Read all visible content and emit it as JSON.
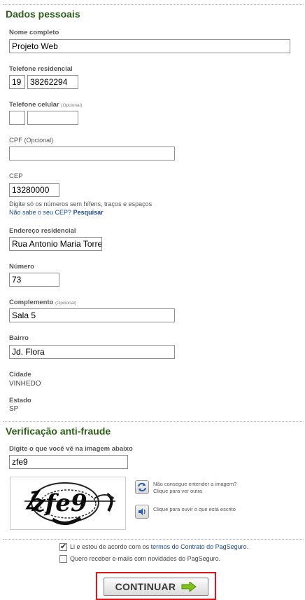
{
  "personal": {
    "title": "Dados pessoais",
    "name": {
      "label": "Nome completo",
      "value": "Projeto Web"
    },
    "home_phone": {
      "label": "Telefone residencial",
      "ddd": "19",
      "number": "38262294"
    },
    "mobile_phone": {
      "label": "Telefone celular",
      "optional": "(Opcional)",
      "ddd": "",
      "number": ""
    },
    "cpf": {
      "label": "CPF",
      "optional": "(Opcional)",
      "value": ""
    },
    "cep": {
      "label": "CEP",
      "value": "13280000",
      "hint": "Digite só os números sem hífens, traços e espaços",
      "forgot": "Não sabe o seu CEP?",
      "search_link": "Pesquisar"
    },
    "address": {
      "label": "Endereço residencial",
      "value": "Rua Antonio Maria Torre"
    },
    "number": {
      "label": "Número",
      "value": "73"
    },
    "complement": {
      "label": "Complemento",
      "optional": "(Opcional)",
      "value": "Sala 5"
    },
    "district": {
      "label": "Bairro",
      "value": "Jd. Flora"
    },
    "city": {
      "label": "Cidade",
      "value": "VINHEDO"
    },
    "state": {
      "label": "Estado",
      "value": "SP"
    }
  },
  "antifraud": {
    "title": "Verificação anti-fraude",
    "prompt": "Digite o que você vê na imagem abaixo",
    "value": "zfe9",
    "captcha_text": "zfe9",
    "refresh_line1": "Não consegue entender a imagem?",
    "refresh_line2": "Clique para ver outra",
    "audio_text": "Clique para ouvir o que está escrito",
    "refresh_icon": "refresh-icon",
    "audio_icon": "speaker-icon"
  },
  "agreement": {
    "terms_prefix": "Li e estou de acordo com os",
    "terms_link": "termos do Contrato do PagSeguro",
    "terms_suffix": ".",
    "terms_checked": true,
    "newsletter": "Quero receber e-mails com novidades do PagSeguro.",
    "newsletter_checked": false
  },
  "submit": {
    "label": "CONTINUAR",
    "icon": "arrow-right-icon"
  },
  "colors": {
    "title": "#2f5d1a",
    "link": "#1a4a8a",
    "highlight": "#e0141b",
    "arrow": "#7cc21a"
  }
}
